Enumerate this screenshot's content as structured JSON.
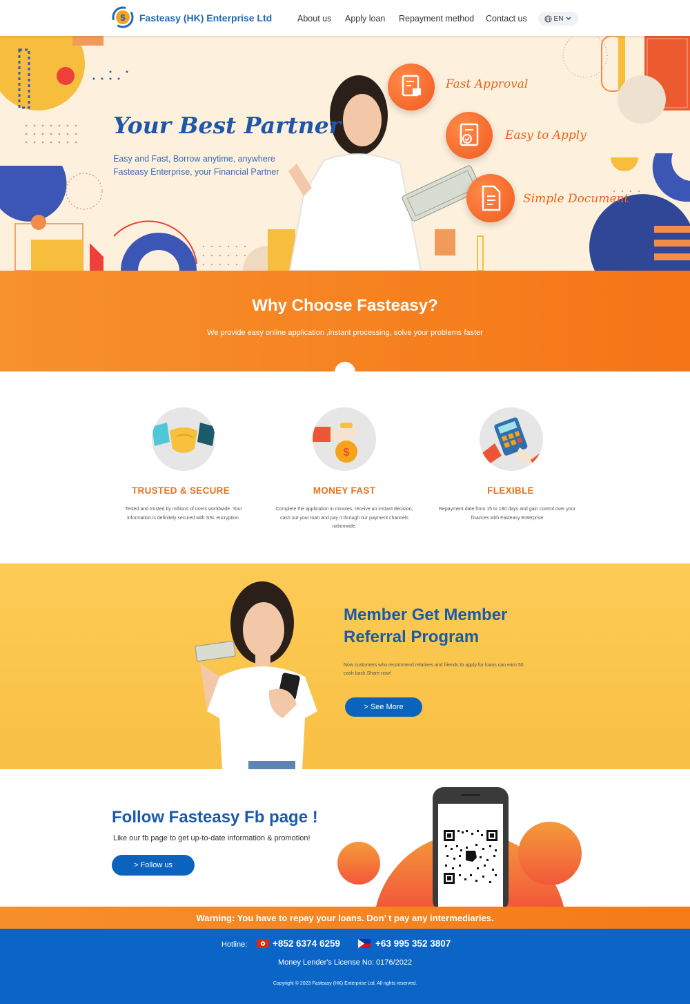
{
  "header": {
    "brand": "Fasteasy (HK) Enterprise Ltd",
    "nav": [
      "About us",
      "Apply loan",
      "Repayment method",
      "Contact us"
    ],
    "lang": "EN"
  },
  "hero": {
    "title": "Your Best Partner",
    "subtitle_1": "Easy and Fast, Borrow anytime, anywhere",
    "subtitle_2": "Fasteasy Enterprise, your Financial Partner",
    "features": [
      "Fast Approval",
      "Easy to Apply",
      "Simple Document"
    ]
  },
  "why": {
    "title": "Why Choose Fasteasy?",
    "subtitle": "We provide easy online application ,instant processing, solve your problems faster"
  },
  "features": [
    {
      "title": "TRUSTED & SECURE",
      "desc": "Tested and trusted by millions of users worldwide. Your information is definitely secured with SSL encryption."
    },
    {
      "title": "MONEY FAST",
      "desc": "Complete the application in minutes, receive an instant decision, cash out your loan and pay it through our payment channels nationwide."
    },
    {
      "title": "FLEXIBLE",
      "desc": "Repayment date from 15 to 180 days and gain control over your finances with Fasteasy Enterprise"
    }
  ],
  "referral": {
    "title_1": "Member Get Member",
    "title_2": "Referral  Program",
    "desc": "Now customers who recommend relatives and friends to apply for loans can earn 50 cash back.Share now!",
    "button": "> See More"
  },
  "follow": {
    "title": "Follow Fasteasy Fb page !",
    "subtitle": "Like our fb page to get up-to-date information & promotion!",
    "button": "> Follow us"
  },
  "warning": "Warning: You have to repay your loans. Don’ t pay any intermediaries.",
  "footer": {
    "hotline_label": "Hotline:",
    "phone_hk": "+852 6374 6259",
    "phone_ph": "+63 995 352 3807",
    "license": "Money Lender's License No: 0176/2022",
    "copyright": "Copyright © 2023 Fasteasy (HK) Enterprise Ltd. All rights reserved."
  }
}
